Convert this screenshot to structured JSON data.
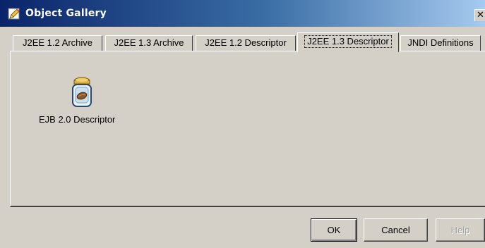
{
  "window": {
    "title": "Object Gallery",
    "close_glyph": "✕",
    "title_icon": "pencil-icon"
  },
  "tabs": [
    {
      "label": "J2EE 1.2 Archive",
      "selected": false
    },
    {
      "label": "J2EE 1.3 Archive",
      "selected": false
    },
    {
      "label": "J2EE 1.2 Descriptor",
      "selected": false
    },
    {
      "label": "J2EE 1.3 Descriptor",
      "selected": true
    },
    {
      "label": "JNDI Definitions",
      "selected": false
    }
  ],
  "gallery": {
    "items": [
      {
        "label": "EJB 2.0 Descriptor",
        "icon": "jar-icon"
      }
    ]
  },
  "buttons": {
    "ok_label": "OK",
    "cancel_label": "Cancel",
    "help_label": "Help"
  }
}
